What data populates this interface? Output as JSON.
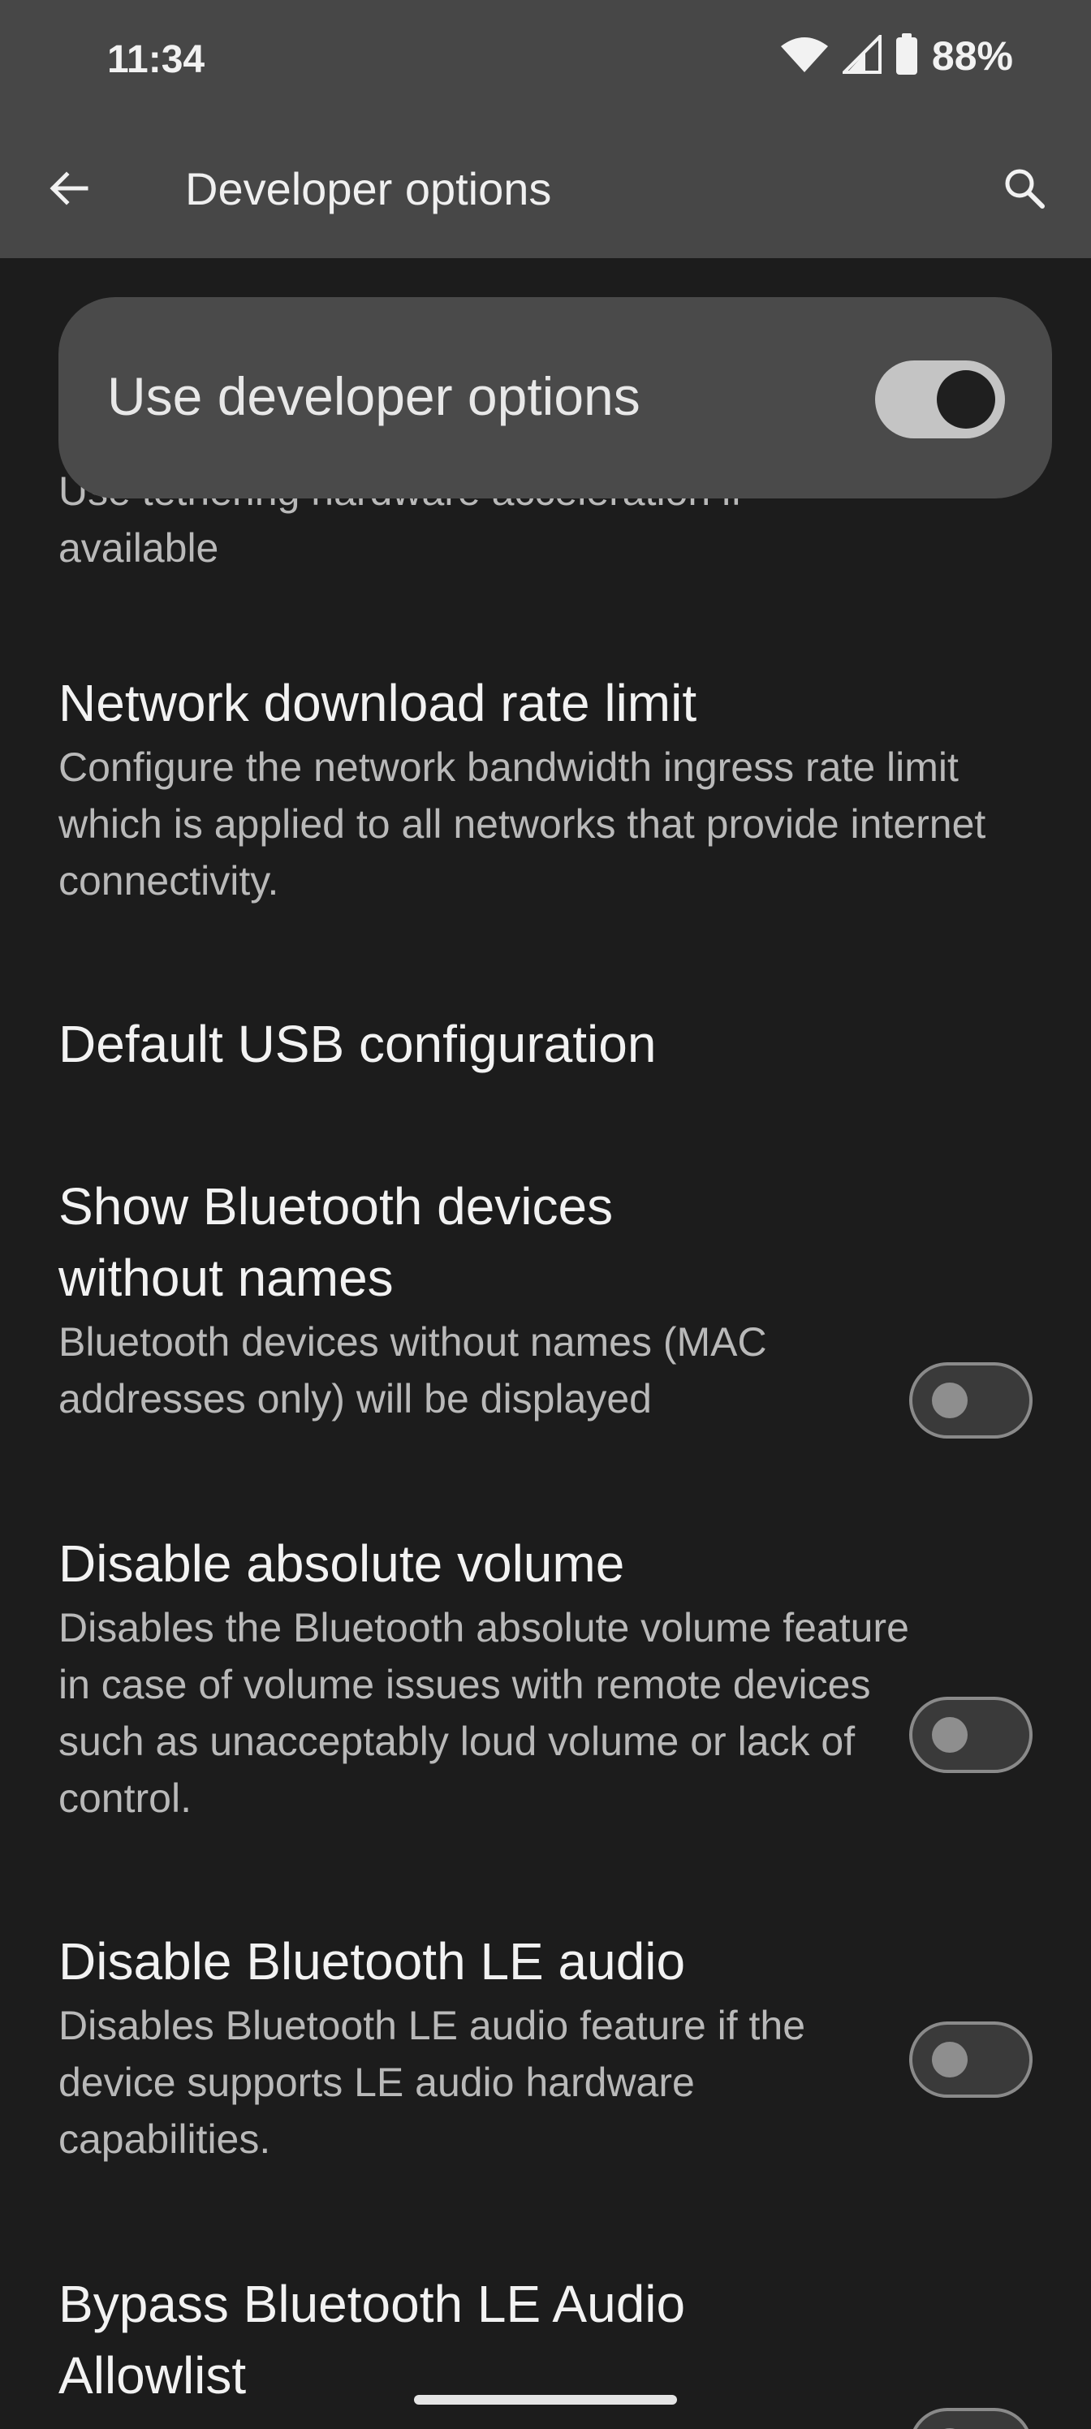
{
  "status_bar": {
    "time": "11:34",
    "battery": "88%",
    "icons": [
      "wifi-icon",
      "signal-icon",
      "battery-icon"
    ]
  },
  "app_bar": {
    "title": "Developer options",
    "back_icon": "arrow-left-icon",
    "search_icon": "search-icon"
  },
  "main_switch": {
    "label": "Use developer options",
    "checked": true
  },
  "partial_item": {
    "summary": "Use tethering hardware acceleration if available"
  },
  "settings": [
    {
      "title": "Network download rate limit",
      "summary": "Configure the network bandwidth ingress rate limit which is applied to all networks that provide internet connectivity."
    },
    {
      "title": "Default USB configuration",
      "summary": ""
    },
    {
      "title": "Show Bluetooth devices without names",
      "summary": "Bluetooth devices without names (MAC addresses only) will be displayed",
      "toggle": false
    },
    {
      "title": "Disable absolute volume",
      "summary": "Disables the Bluetooth absolute volume feature in case of volume issues with remote devices such as unacceptably loud volume or lack of control.",
      "toggle": false
    },
    {
      "title": "Disable Bluetooth LE audio",
      "summary": "Disables Bluetooth LE audio feature if the device supports LE audio hardware capabilities.",
      "toggle": false
    },
    {
      "title": "Bypass Bluetooth LE Audio Allowlist",
      "summary": "",
      "toggle": false
    }
  ],
  "colors": {
    "background": "#1c1c1c",
    "app_bar": "#474747",
    "main_switch_card": "#4a4a4a",
    "title_text": "#f2f2f2",
    "summary_text": "#b9b9b9"
  }
}
